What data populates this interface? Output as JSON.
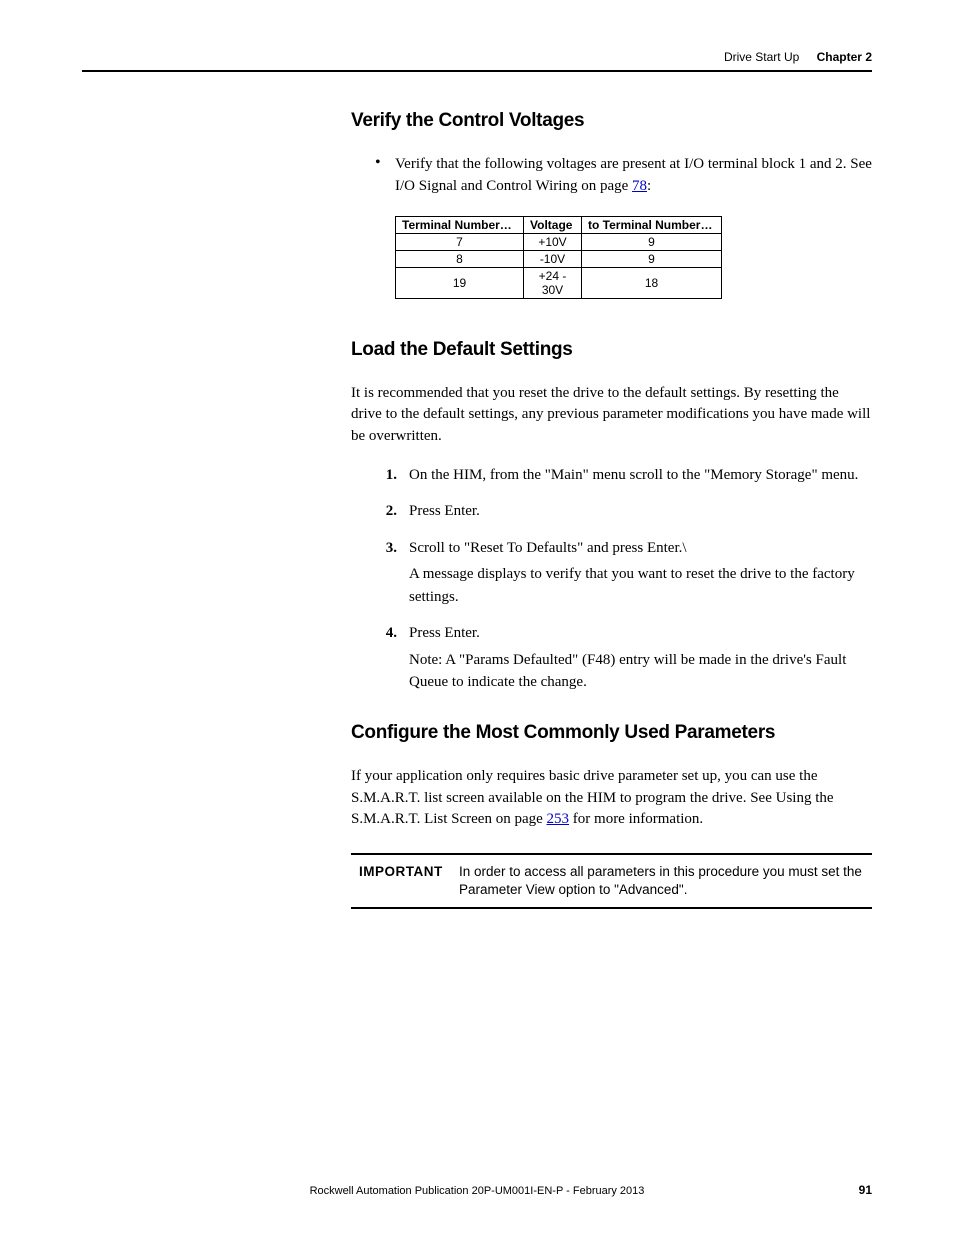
{
  "header": {
    "section": "Drive Start Up",
    "chapter": "Chapter 2"
  },
  "sec1": {
    "title": "Verify the Control Voltages",
    "bullet_lead": "Verify that the following voltages are present at I/O terminal block 1 and 2. See I/O Signal and Control Wiring on page ",
    "bullet_link": "78",
    "bullet_tail": ":",
    "th1": "Terminal Number…",
    "th2": "Voltage",
    "th3": "to Terminal Number…",
    "rows": [
      {
        "a": "7",
        "b": "+10V",
        "c": "9"
      },
      {
        "a": "8",
        "b": "-10V",
        "c": "9"
      },
      {
        "a": "19",
        "b": "+24 - 30V",
        "c": "18"
      }
    ]
  },
  "sec2": {
    "title": "Load the Default Settings",
    "intro": "It is recommended that you reset the drive to the default settings. By resetting the drive to the default settings, any previous parameter modifications you have made will be overwritten.",
    "steps": [
      {
        "n": "1.",
        "t": "On the HIM, from the \"Main\" menu scroll to the \"Memory Storage\" menu."
      },
      {
        "n": "2.",
        "t": "Press Enter."
      },
      {
        "n": "3.",
        "t": "Scroll to \"Reset To Defaults\" and press Enter.\\",
        "sub": "A message displays to verify that you want to reset the drive to the factory settings."
      },
      {
        "n": "4.",
        "t": "Press Enter.",
        "sub": "Note: A \"Params Defaulted\" (F48) entry will be made in the drive's Fault Queue to indicate the change."
      }
    ]
  },
  "sec3": {
    "title": "Configure the Most Commonly Used Parameters",
    "para_lead": "If your application only requires basic drive parameter set up, you can use the S.M.A.R.T. list screen available on the HIM to program the drive. See Using the S.M.A.R.T. List Screen on page ",
    "para_link": "253",
    "para_tail": " for more information.",
    "important_label": "IMPORTANT",
    "important_text": "In order to access all parameters in this procedure you must set the Parameter View option to \"Advanced\"."
  },
  "footer": {
    "pub": "Rockwell Automation Publication 20P-UM001I-EN-P - February 2013",
    "page": "91"
  }
}
